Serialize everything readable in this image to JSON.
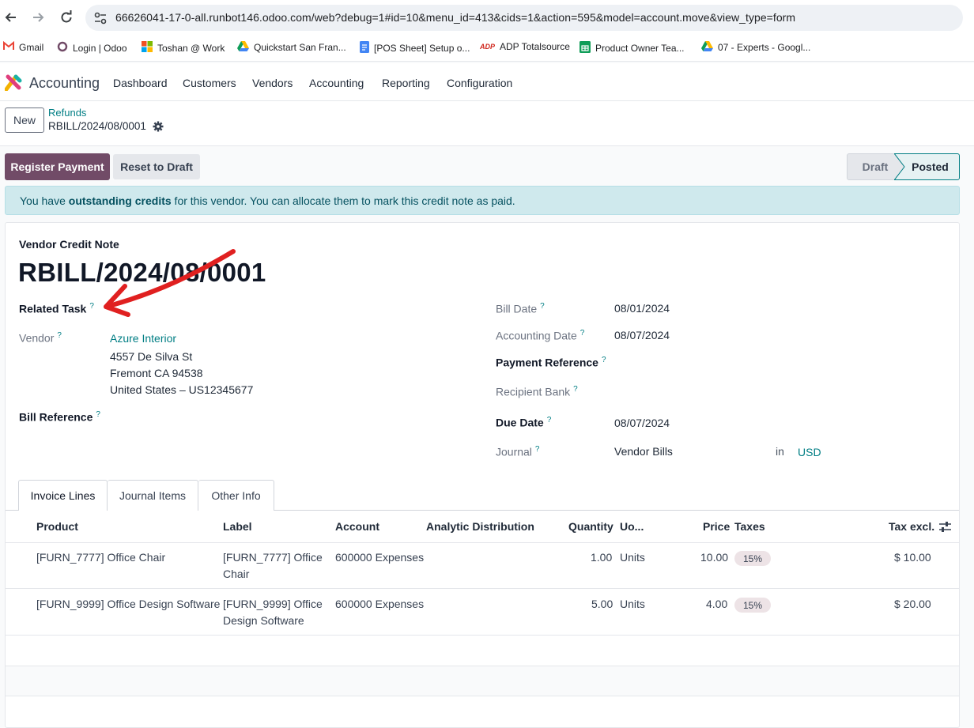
{
  "browser": {
    "url": "66626041-17-0-all.runbot146.odoo.com/web?debug=1#id=10&menu_id=413&cids=1&action=595&model=account.move&view_type=form",
    "bookmarks": [
      "Gmail",
      "Login | Odoo",
      "Toshan @ Work",
      "Quickstart San Fran...",
      "[POS Sheet] Setup o...",
      "ADP Totalsource",
      "Product Owner Tea...",
      "07 - Experts - Googl..."
    ]
  },
  "navbar": {
    "app_name": "Accounting",
    "menu": [
      "Dashboard",
      "Customers",
      "Vendors",
      "Accounting",
      "Reporting",
      "Configuration"
    ]
  },
  "control_panel": {
    "new_label": "New",
    "breadcrumb_parent": "Refunds",
    "breadcrumb_current": "RBILL/2024/08/0001"
  },
  "actions": {
    "register_payment": "Register Payment",
    "reset_to_draft": "Reset to Draft"
  },
  "statusbar": {
    "draft": "Draft",
    "posted": "Posted"
  },
  "alert": {
    "prefix": "You have ",
    "bold": "outstanding credits",
    "suffix": " for this vendor. You can allocate them to mark this credit note as paid."
  },
  "form": {
    "doc_type": "Vendor Credit Note",
    "doc_name": "RBILL/2024/08/0001",
    "related_task_label": "Related Task",
    "vendor_label": "Vendor",
    "vendor_name": "Azure Interior",
    "vendor_address": [
      "4557 De Silva St",
      "Fremont CA 94538",
      "United States – US12345677"
    ],
    "bill_reference_label": "Bill Reference",
    "bill_date_label": "Bill Date",
    "bill_date": "08/01/2024",
    "accounting_date_label": "Accounting Date",
    "accounting_date": "08/07/2024",
    "payment_reference_label": "Payment Reference",
    "recipient_bank_label": "Recipient Bank",
    "due_date_label": "Due Date",
    "due_date": "08/07/2024",
    "journal_label": "Journal",
    "journal": "Vendor Bills",
    "in_label": "in",
    "currency": "USD",
    "help_mark": "?"
  },
  "tabs": [
    "Invoice Lines",
    "Journal Items",
    "Other Info"
  ],
  "table": {
    "headers": [
      "Product",
      "Label",
      "Account",
      "Analytic Distribution",
      "Quantity",
      "Uo...",
      "Price",
      "Taxes",
      "Tax excl."
    ],
    "rows": [
      {
        "product": "[FURN_7777] Office Chair",
        "label_l1": "[FURN_7777] Office",
        "label_l2": "Chair",
        "account": "600000 Expenses",
        "quantity": "1.00",
        "uom": "Units",
        "price": "10.00",
        "tax": "15%",
        "subtotal": "$ 10.00"
      },
      {
        "product": "[FURN_9999] Office Design Software",
        "label_l1": "[FURN_9999] Office",
        "label_l2": "Design Software",
        "account": "600000 Expenses",
        "quantity": "5.00",
        "uom": "Units",
        "price": "4.00",
        "tax": "15%",
        "subtotal": "$ 20.00"
      }
    ]
  },
  "colors": {
    "brand": "#714b67",
    "link": "#017e84",
    "alert_bg": "#cfe9ed",
    "annotation": "#e02020"
  }
}
